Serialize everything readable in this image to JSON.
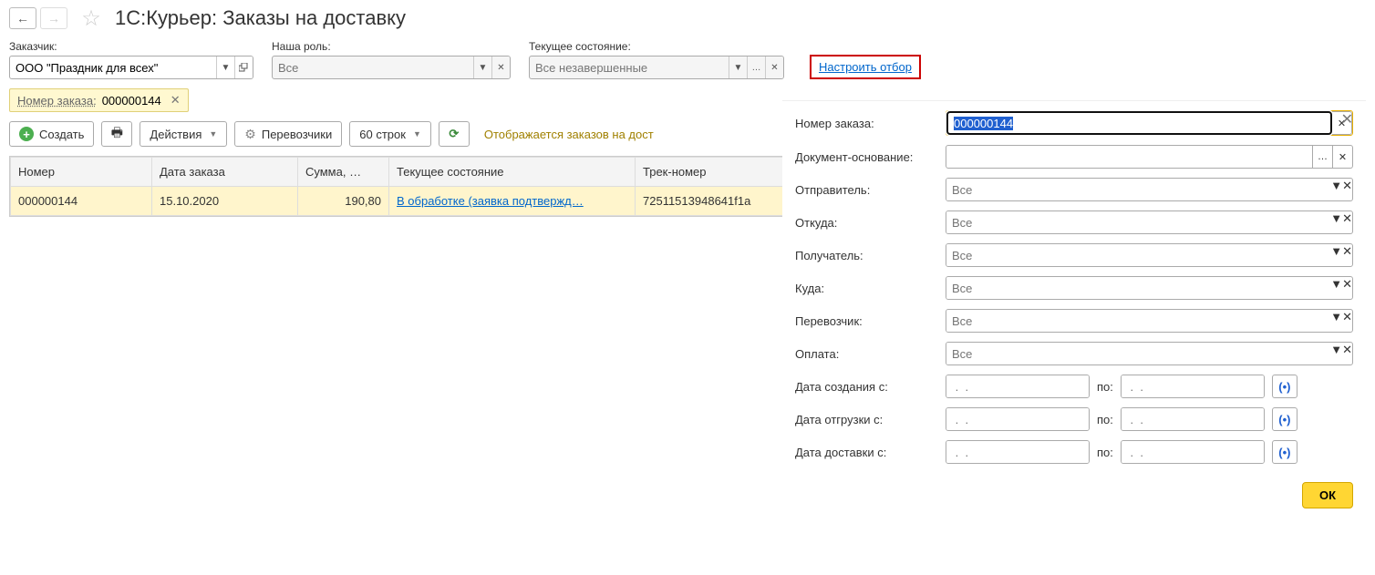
{
  "header": {
    "title": "1С:Курьер: Заказы на доставку"
  },
  "topFilters": {
    "customer": {
      "label": "Заказчик:",
      "value": "ООО \"Праздник для всех\""
    },
    "role": {
      "label": "Наша роль:",
      "placeholder": "Все"
    },
    "state": {
      "label": "Текущее состояние:",
      "placeholder": "Все незавершенные"
    },
    "configure": "Настроить отбор"
  },
  "chip": {
    "label": "Номер заказа:",
    "value": "000000144"
  },
  "toolbar": {
    "create": "Создать",
    "actions": "Действия",
    "carriers": "Перевозчики",
    "lines": "60 строк",
    "summary": "Отображается заказов на дост"
  },
  "table": {
    "headers": {
      "num": "Номер",
      "date": "Дата заказа",
      "sum": "Сумма, …",
      "state": "Текущее состояние",
      "track": "Трек-номер"
    },
    "row": {
      "num": "000000144",
      "date": "15.10.2020",
      "sum": "190,80",
      "state": "В обработке (заявка подтвержд…",
      "track": "72511513948641f1a"
    }
  },
  "panel": {
    "orderNum": {
      "label": "Номер заказа:",
      "value": "000000144"
    },
    "baseDoc": {
      "label": "Документ-основание:"
    },
    "sender": {
      "label": "Отправитель:",
      "placeholder": "Все"
    },
    "from": {
      "label": "Откуда:",
      "placeholder": "Все"
    },
    "recipient": {
      "label": "Получатель:",
      "placeholder": "Все"
    },
    "to": {
      "label": "Куда:",
      "placeholder": "Все"
    },
    "carrier": {
      "label": "Перевозчик:",
      "placeholder": "Все"
    },
    "payment": {
      "label": "Оплата:",
      "placeholder": "Все"
    },
    "createdFrom": {
      "label": "Дата создания с:"
    },
    "shippedFrom": {
      "label": "Дата отгрузки с:"
    },
    "deliveredFrom": {
      "label": "Дата доставки с:"
    },
    "to_label": "по:",
    "datePlaceholder": " .  .",
    "ok": "ОК"
  }
}
